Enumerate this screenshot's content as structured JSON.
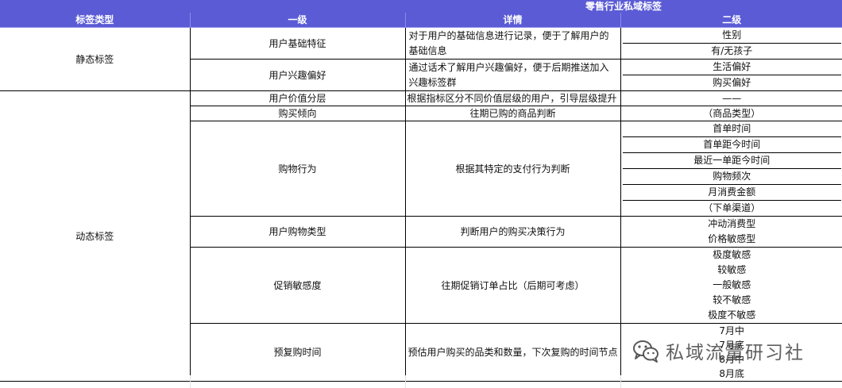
{
  "sheet_title": "零售行业私域标签",
  "headers": {
    "type": "标签类型",
    "level1": "一级",
    "detail": "详情",
    "level2": "二级"
  },
  "groups": [
    {
      "type": "静态标签",
      "rows": [
        {
          "level1": "用户基础特征",
          "detail": "对于用户的基础信息进行记录，便于了解用户的基础信息",
          "level2": [
            "性别",
            "有/无孩子"
          ]
        },
        {
          "level1": "用户兴趣偏好",
          "detail": "通过话术了解用户兴趣偏好，便于后期推送加入兴趣标签群",
          "level2": [
            "生活偏好",
            "购买偏好"
          ]
        }
      ]
    },
    {
      "type": "动态标签",
      "rows": [
        {
          "level1": "用户价值分层",
          "detail": "根据指标区分不同价值层级的用户，引导层级提升",
          "level2": [
            "——"
          ]
        },
        {
          "level1": "购买倾向",
          "detail": "往期已购的商品判断",
          "level2": [
            "（商品类型）"
          ]
        },
        {
          "level1": "购物行为",
          "detail": "根据其特定的支付行为判断",
          "level2": [
            "首单时间",
            "首单距今时间",
            "最近一单距今时间",
            "购物频次",
            "月消费金额",
            "（下单渠道）"
          ]
        },
        {
          "level1": "用户购物类型",
          "detail": "判断用户的购买决策行为",
          "level2": [
            "冲动消费型",
            "价格敏感型"
          ]
        },
        {
          "level1": "促销敏感度",
          "detail": "往期促销订单占比（后期可考虑）",
          "level2": [
            "极度敏感",
            "较敏感",
            "一般敏感",
            "较不敏感",
            "极度不敏感"
          ]
        },
        {
          "level1": "预复购时间",
          "detail": "预估用户购买的品类和数量，下次复购的时间节点",
          "level2": [
            "7月中",
            "7月底",
            "8月中",
            "8月底"
          ]
        }
      ]
    }
  ],
  "watermark": {
    "text": "私域流量研习社",
    "icon": "wechat-icon"
  },
  "colors": {
    "header_bg": "#5b5bd6",
    "header_text": "#ffffff",
    "border": "#000000"
  }
}
